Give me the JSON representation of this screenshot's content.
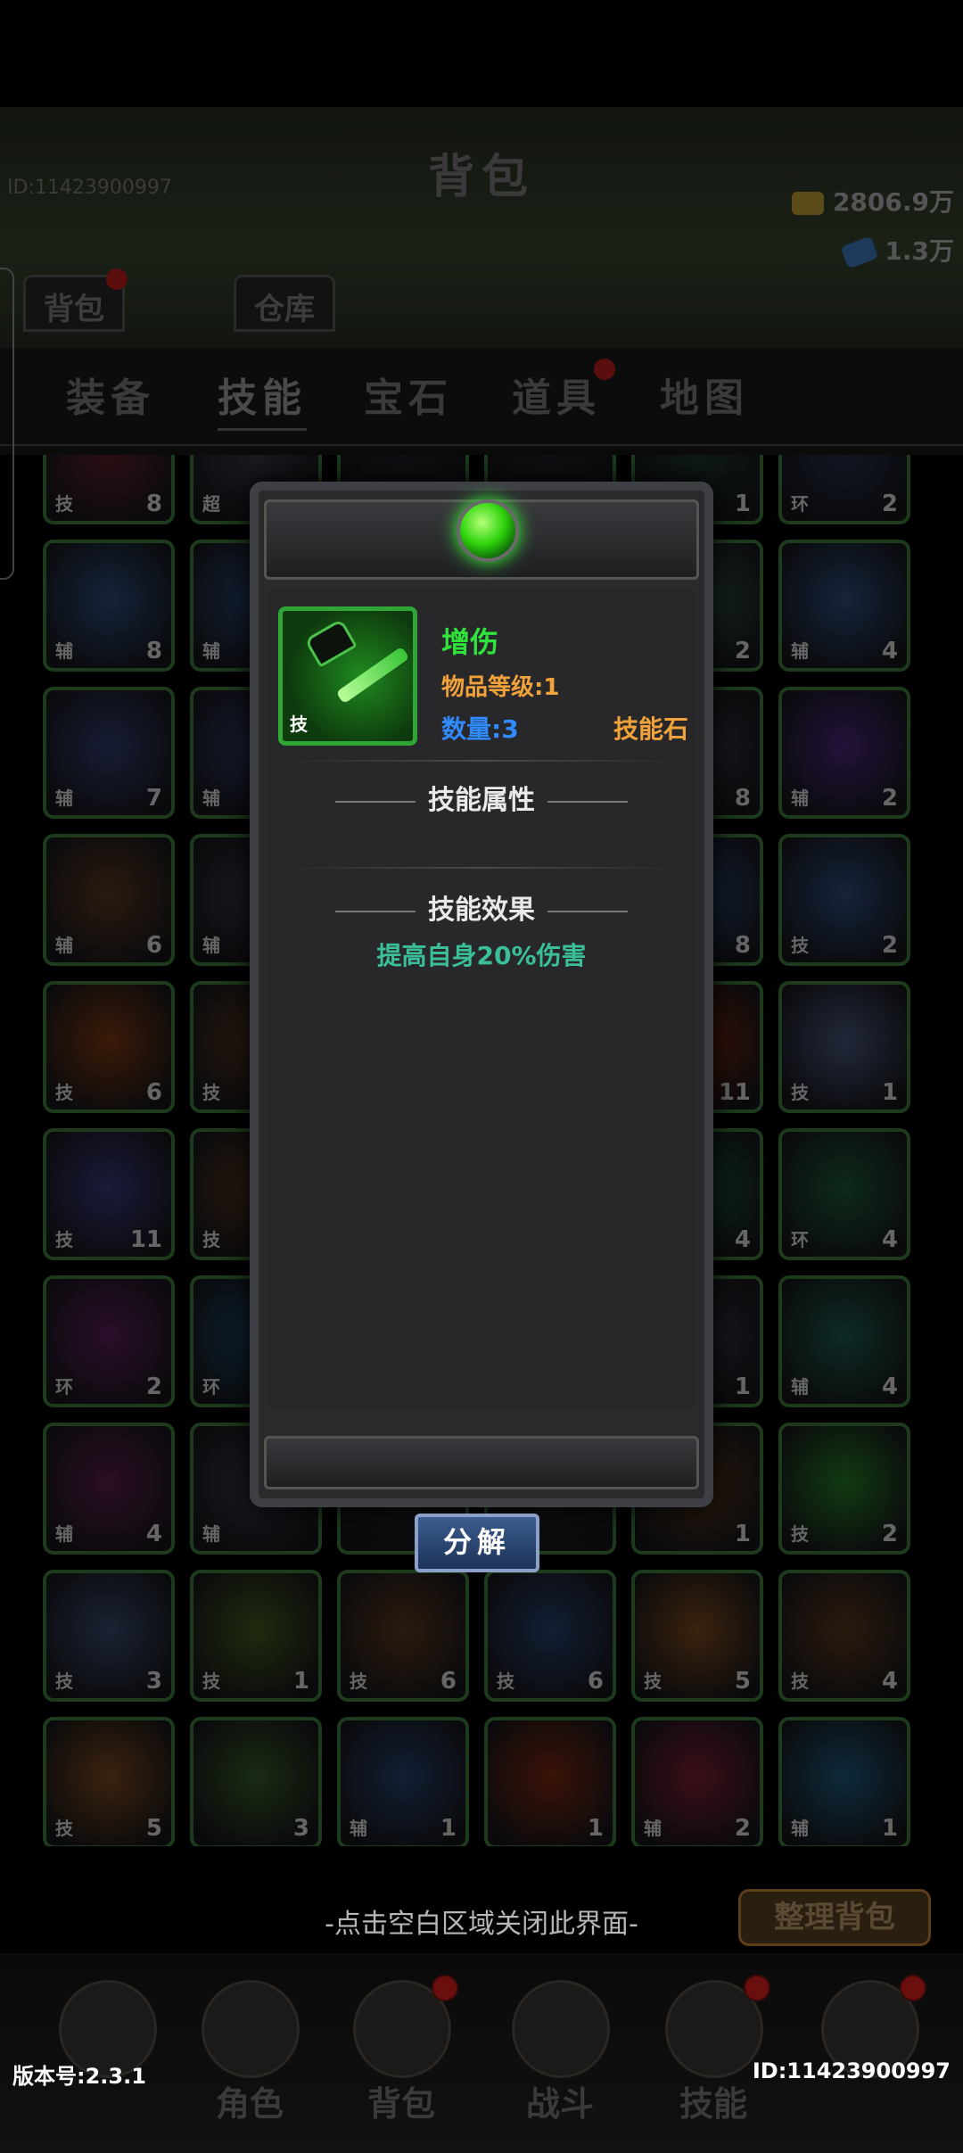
{
  "header": {
    "title": "背包",
    "player_id": "ID:11423900997",
    "gold": "2806.9万",
    "gems": "1.3万"
  },
  "subtabs": [
    {
      "label": "背包"
    },
    {
      "label": "仓库"
    }
  ],
  "tabs": [
    {
      "label": "装备"
    },
    {
      "label": "技能"
    },
    {
      "label": "宝石"
    },
    {
      "label": "道具"
    },
    {
      "label": "地图"
    }
  ],
  "grid": {
    "items": [
      {
        "badge": "技",
        "count": "8",
        "color": "#2a0f14"
      },
      {
        "badge": "超",
        "count": "",
        "color": "#1a1a22"
      },
      {
        "badge": "",
        "count": "",
        "color": "#101014"
      },
      {
        "badge": "",
        "count": "",
        "color": "#101014"
      },
      {
        "badge": "",
        "count": "1",
        "color": "#0e1a14"
      },
      {
        "badge": "环",
        "count": "2",
        "color": "#101622"
      },
      {
        "badge": "辅",
        "count": "8",
        "color": "#15233a"
      },
      {
        "badge": "辅",
        "count": "",
        "color": "#15233a"
      },
      {
        "badge": "",
        "count": "",
        "color": "#101014"
      },
      {
        "badge": "",
        "count": "",
        "color": "#101014"
      },
      {
        "badge": "",
        "count": "2",
        "color": "#1a2a22"
      },
      {
        "badge": "辅",
        "count": "4",
        "color": "#15233a"
      },
      {
        "badge": "辅",
        "count": "7",
        "color": "#171c33"
      },
      {
        "badge": "辅",
        "count": "",
        "color": "#171c33"
      },
      {
        "badge": "",
        "count": "",
        "color": "#101014"
      },
      {
        "badge": "",
        "count": "",
        "color": "#101014"
      },
      {
        "badge": "",
        "count": "8",
        "color": "#1a1a22"
      },
      {
        "badge": "辅",
        "count": "2",
        "color": "#22123a"
      },
      {
        "badge": "辅",
        "count": "6",
        "color": "#2a1a10"
      },
      {
        "badge": "辅",
        "count": "",
        "color": "#1a1a22"
      },
      {
        "badge": "",
        "count": "",
        "color": "#101014"
      },
      {
        "badge": "",
        "count": "",
        "color": "#101014"
      },
      {
        "badge": "",
        "count": "8",
        "color": "#15233a"
      },
      {
        "badge": "技",
        "count": "2",
        "color": "#15233a"
      },
      {
        "badge": "技",
        "count": "6",
        "color": "#3a1a08"
      },
      {
        "badge": "技",
        "count": "",
        "color": "#2a1a10"
      },
      {
        "badge": "",
        "count": "",
        "color": "#101014"
      },
      {
        "badge": "",
        "count": "",
        "color": "#101014"
      },
      {
        "badge": "",
        "count": "11",
        "color": "#3a1208"
      },
      {
        "badge": "技",
        "count": "1",
        "color": "#22283a"
      },
      {
        "badge": "技",
        "count": "11",
        "color": "#1a1a3a"
      },
      {
        "badge": "技",
        "count": "",
        "color": "#2a1a10"
      },
      {
        "badge": "",
        "count": "",
        "color": "#101014"
      },
      {
        "badge": "",
        "count": "",
        "color": "#101014"
      },
      {
        "badge": "",
        "count": "4",
        "color": "#0e2a1a"
      },
      {
        "badge": "环",
        "count": "4",
        "color": "#0e2a1a"
      },
      {
        "badge": "环",
        "count": "2",
        "color": "#2a0e2a"
      },
      {
        "badge": "环",
        "count": "",
        "color": "#0e2233"
      },
      {
        "badge": "",
        "count": "",
        "color": "#101014"
      },
      {
        "badge": "",
        "count": "",
        "color": "#101014"
      },
      {
        "badge": "",
        "count": "1",
        "color": "#1a1a22"
      },
      {
        "badge": "辅",
        "count": "4",
        "color": "#0e2a24"
      },
      {
        "badge": "辅",
        "count": "4",
        "color": "#2a0e22"
      },
      {
        "badge": "辅",
        "count": "",
        "color": "#1a1a22"
      },
      {
        "badge": "",
        "count": "",
        "color": "#101014"
      },
      {
        "badge": "",
        "count": "",
        "color": "#101014"
      },
      {
        "badge": "",
        "count": "1",
        "color": "#2a1a0e"
      },
      {
        "badge": "技",
        "count": "2",
        "color": "#123a12"
      },
      {
        "badge": "技",
        "count": "3",
        "color": "#1a2233"
      },
      {
        "badge": "技",
        "count": "1",
        "color": "#1f2a0e"
      },
      {
        "badge": "技",
        "count": "6",
        "color": "#2a1a0e"
      },
      {
        "badge": "技",
        "count": "6",
        "color": "#121e33"
      },
      {
        "badge": "技",
        "count": "5",
        "color": "#3a220e"
      },
      {
        "badge": "技",
        "count": "4",
        "color": "#2a1a0e"
      },
      {
        "badge": "技",
        "count": "5",
        "color": "#3a220e"
      },
      {
        "badge": "",
        "count": "3",
        "color": "#1a2a12"
      },
      {
        "badge": "辅",
        "count": "1",
        "color": "#121e33"
      },
      {
        "badge": "",
        "count": "1",
        "color": "#3a1208"
      },
      {
        "badge": "辅",
        "count": "2",
        "color": "#3a0e18"
      },
      {
        "badge": "辅",
        "count": "1",
        "color": "#0e2a3a"
      }
    ]
  },
  "dialog": {
    "item": {
      "icon": "dagger-potion-icon",
      "icon_tag": "技",
      "name": "增伤",
      "level": "物品等级:1",
      "quantity": "数量:3",
      "type": "技能石"
    },
    "attributes_title": "技能属性",
    "effect_title": "技能效果",
    "effect_text": "提高自身20%伤害",
    "decompose_label": "分解"
  },
  "footer": {
    "close_hint": "-点击空白区域关闭此界面-",
    "sort_label": "整理背包",
    "version": "版本号:2.3.1",
    "player_id": "ID:11423900997"
  },
  "bottom_nav": [
    {
      "label": "",
      "icon": "sword-emblem-icon"
    },
    {
      "label": "角色",
      "icon": "hooded-hero-icon"
    },
    {
      "label": "背包",
      "icon": "bag-icon"
    },
    {
      "label": "战斗",
      "icon": "vortex-icon"
    },
    {
      "label": "技能",
      "icon": "skill-book-icon"
    },
    {
      "label": "",
      "icon": "pet-icon"
    }
  ]
}
